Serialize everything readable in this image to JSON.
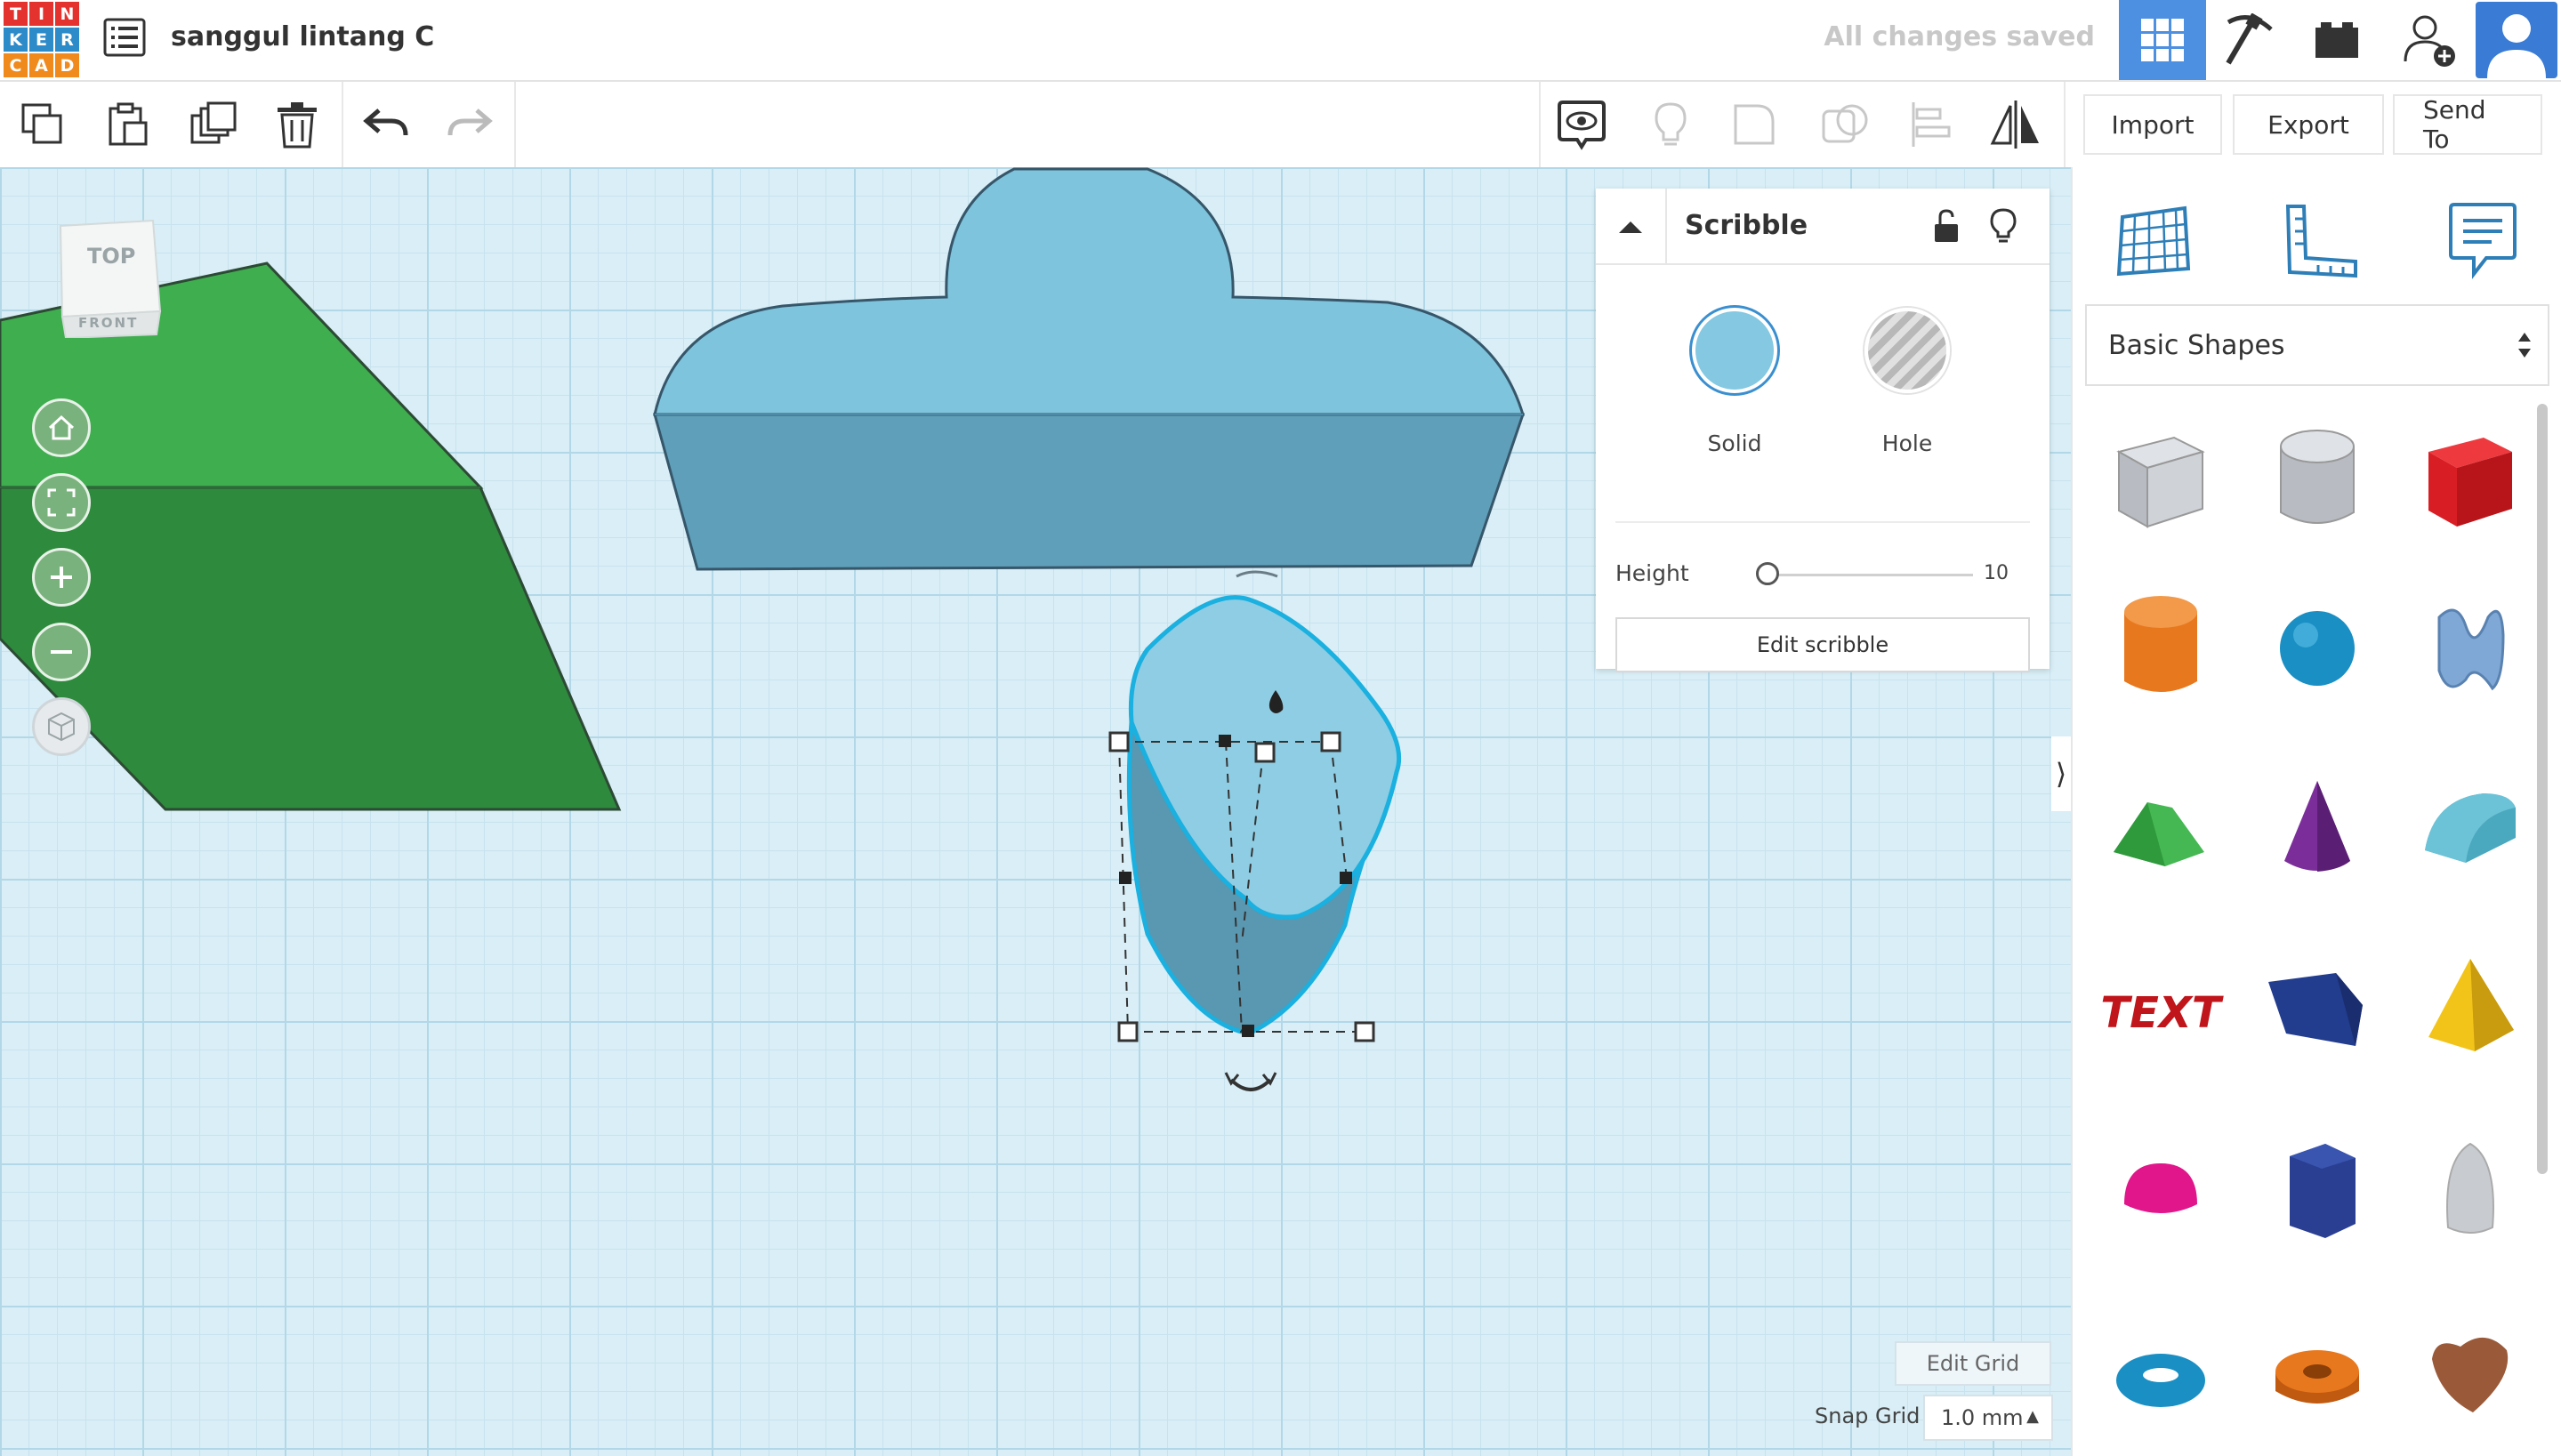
{
  "app": {
    "logo_letters": [
      "T",
      "I",
      "N",
      "K",
      "E",
      "R",
      "C",
      "A",
      "D"
    ],
    "logo_colors": [
      "#e4332f",
      "#e4332f",
      "#e4332f",
      "#2e8bc9",
      "#2e8bc9",
      "#2e8bc9",
      "#f08a1d",
      "#f08a1d",
      "#f08a1d"
    ],
    "design_title": "sanggul lintang C",
    "save_status": "All changes saved",
    "accent_color": "#4d8fe0"
  },
  "toolbar": {
    "import_label": "Import",
    "export_label": "Export",
    "send_to_label": "Send To"
  },
  "viewcube": {
    "top_label": "TOP",
    "front_label": "FRONT"
  },
  "inspector": {
    "title": "Scribble",
    "solid_label": "Solid",
    "hole_label": "Hole",
    "solid_color": "#84c8e2",
    "height_label": "Height",
    "height_value": "10",
    "edit_button": "Edit scribble"
  },
  "grid": {
    "edit_grid_label": "Edit Grid",
    "snap_grid_label": "Snap Grid",
    "snap_grid_value": "1.0 mm"
  },
  "shapes_panel": {
    "category": "Basic Shapes",
    "shapes": [
      {
        "name": "box-hole",
        "color": "#b8bcc2"
      },
      {
        "name": "cylinder-hole",
        "color": "#b8bcc2"
      },
      {
        "name": "box",
        "color": "#d81e24"
      },
      {
        "name": "cylinder",
        "color": "#e8781e"
      },
      {
        "name": "sphere",
        "color": "#1a8fc4"
      },
      {
        "name": "scribble",
        "color": "#7fa8d6"
      },
      {
        "name": "roof",
        "color": "#2f9a3c"
      },
      {
        "name": "cone",
        "color": "#7b2e9a"
      },
      {
        "name": "round-roof",
        "color": "#6cc2d6"
      },
      {
        "name": "text",
        "color": "#c0151b"
      },
      {
        "name": "wedge",
        "color": "#223c8e"
      },
      {
        "name": "pyramid",
        "color": "#f2c41a"
      },
      {
        "name": "half-sphere",
        "color": "#e0168a"
      },
      {
        "name": "polygon",
        "color": "#2a3f92"
      },
      {
        "name": "paraboloid",
        "color": "#c8ccd0"
      },
      {
        "name": "torus",
        "color": "#1a8fc4"
      },
      {
        "name": "tube",
        "color": "#e8781e"
      },
      {
        "name": "heart",
        "color": "#9a5a3a"
      }
    ]
  }
}
